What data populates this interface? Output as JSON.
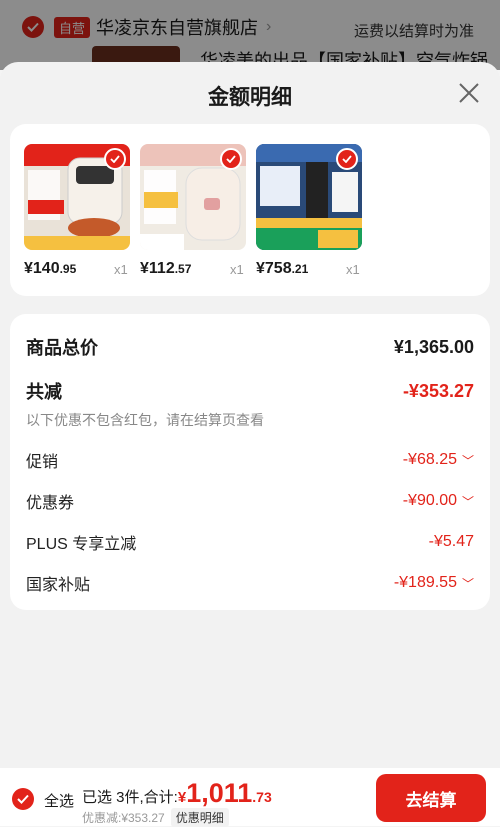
{
  "background": {
    "self_operated_badge": "自营",
    "store_name": "华凌京东自营旗舰店",
    "shipping_note": "运费以结算时为准",
    "product_title_peek": "华凌美的出品【国家补贴】空气炸锅"
  },
  "sheet": {
    "title": "金额明细"
  },
  "products": [
    {
      "price_int": "¥140",
      "price_dec": ".95",
      "qty": "x1",
      "thumb_color": "#e9e2d8"
    },
    {
      "price_int": "¥112",
      "price_dec": ".57",
      "qty": "x1",
      "thumb_color": "#f0ebe3"
    },
    {
      "price_int": "¥758",
      "price_dec": ".21",
      "qty": "x1",
      "thumb_color": "#2a4a78"
    }
  ],
  "summary": {
    "total_label": "商品总价",
    "total_value": "¥1,365.00",
    "reduce_label": "共减",
    "reduce_value": "-¥353.27",
    "reduce_note": "以下优惠不包含红包，请在结算页查看",
    "items": [
      {
        "label": "促销",
        "value": "-¥68.25"
      },
      {
        "label": "优惠券",
        "value": "-¥90.00"
      },
      {
        "label": "PLUS 专享立减",
        "value": "-¥5.47"
      },
      {
        "label": "国家补贴",
        "value": "-¥189.55"
      }
    ]
  },
  "bottom": {
    "select_all": "全选",
    "selected_text": "已选 3件,合计:",
    "currency": "¥",
    "total_int": "1,011",
    "total_dec": ".73",
    "discount_text": "优惠减:¥353.27",
    "detail_tag": "优惠明细",
    "checkout_label": "去结算"
  },
  "colors": {
    "accent": "#e2231a"
  }
}
